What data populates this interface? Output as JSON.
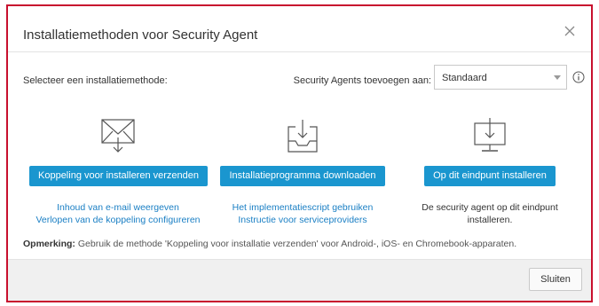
{
  "dialog": {
    "title": "Installatiemethoden voor Security Agent",
    "close_icon": "close-icon"
  },
  "method": {
    "label": "Selecteer een installatiemethode:",
    "agents_label": "Security Agents toevoegen aan:",
    "select_value": "Standaard",
    "info_icon": "info-icon"
  },
  "columns": [
    {
      "icon": "envelope-download-icon",
      "button": "Koppeling voor installeren verzenden",
      "links": [
        "Inhoud van e-mail weergeven",
        "Verlopen van de koppeling configureren"
      ]
    },
    {
      "icon": "tray-download-icon",
      "button": "Installatieprogramma downloaden",
      "links": [
        "Het implementatiescript gebruiken",
        "Instructie voor serviceproviders"
      ]
    },
    {
      "icon": "monitor-download-icon",
      "button": "Op dit eindpunt installeren",
      "text": "De security agent op dit eindpunt installeren."
    }
  ],
  "note": {
    "prefix": "Opmerking:",
    "text": " Gebruik de methode 'Koppeling voor installatie verzenden' voor Android-, iOS- en Chromebook-apparaten."
  },
  "footer": {
    "close_label": "Sluiten"
  },
  "colors": {
    "accent": "#1a96cf",
    "link": "#1a7fc4",
    "frame_border": "#c8102e"
  }
}
